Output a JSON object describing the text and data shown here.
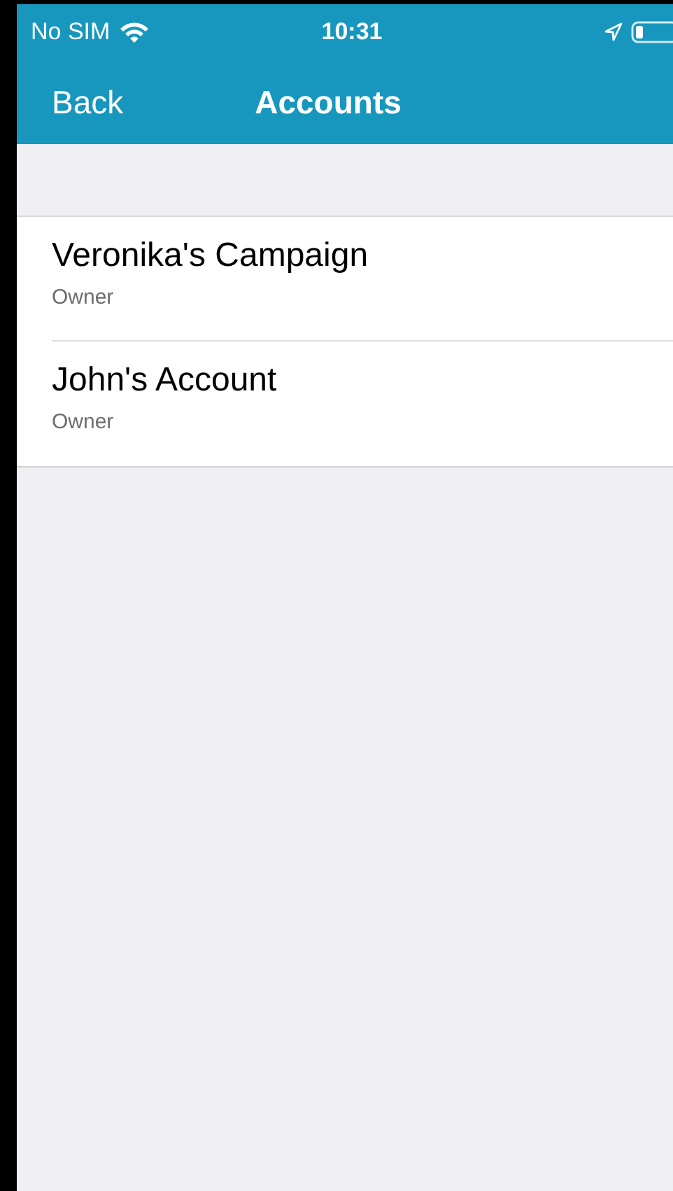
{
  "status_bar": {
    "carrier": "No SIM",
    "time": "10:31"
  },
  "nav_bar": {
    "back": "Back",
    "title": "Accounts"
  },
  "accounts": [
    {
      "name": "Veronika's Campaign",
      "role": "Owner"
    },
    {
      "name": "John's Account",
      "role": "Owner"
    }
  ]
}
